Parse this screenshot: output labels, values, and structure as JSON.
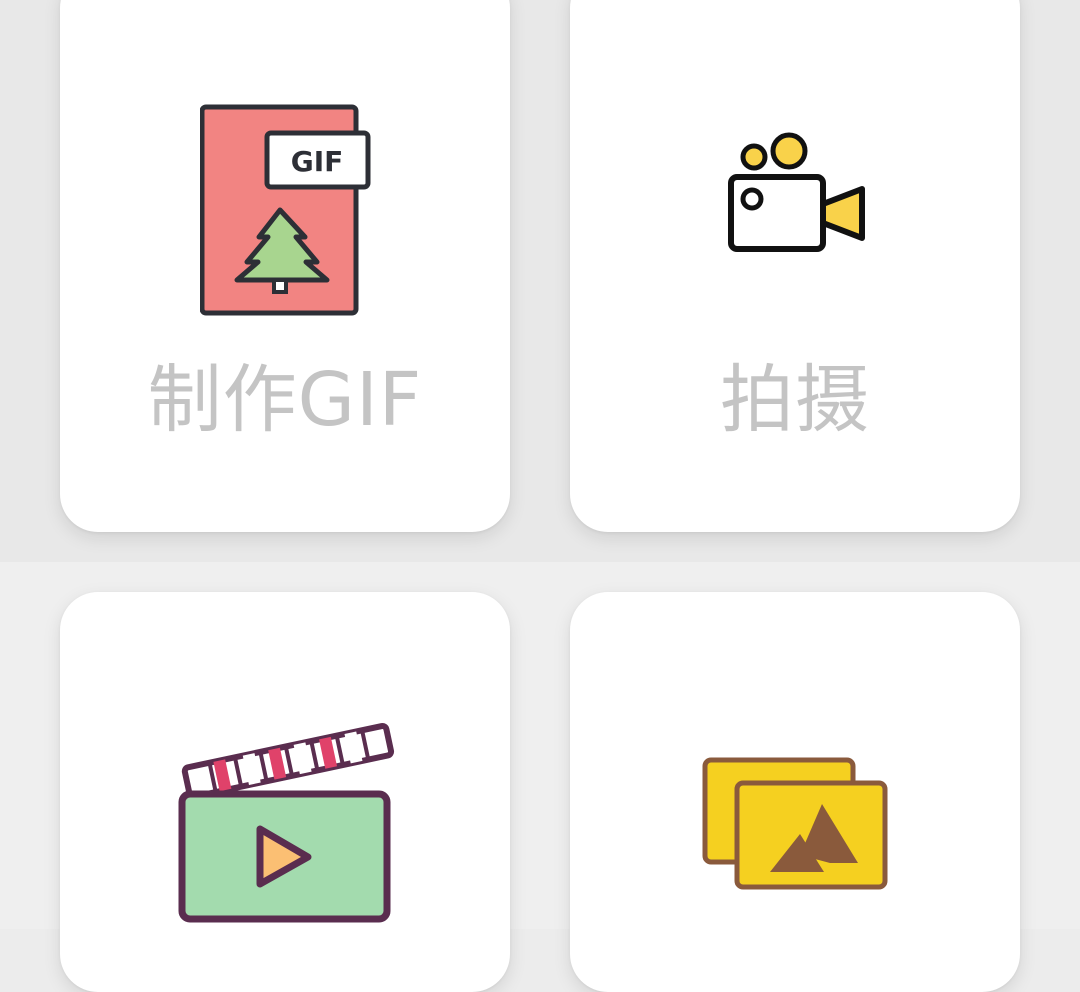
{
  "menu": {
    "items": [
      {
        "label": "制作GIF",
        "icon": "gif-file-icon"
      },
      {
        "label": "拍摄",
        "icon": "video-camera-icon"
      },
      {
        "label": "",
        "icon": "clapperboard-play-icon"
      },
      {
        "label": "",
        "icon": "photo-gallery-icon"
      }
    ]
  },
  "icon_text": {
    "gif_tag": "GIF"
  },
  "colors": {
    "card_background": "#ffffff",
    "label_text": "#c4c4c4",
    "gif_file": "#f28482",
    "tree": "#a8d58f",
    "camera_accent": "#f9d24a",
    "clapper_body": "#a3dbae",
    "clapper_outline": "#5a2d4f",
    "play_triangle": "#fbbf73",
    "gallery_yellow": "#f5d020",
    "mountain_brown": "#8a5a3c"
  }
}
